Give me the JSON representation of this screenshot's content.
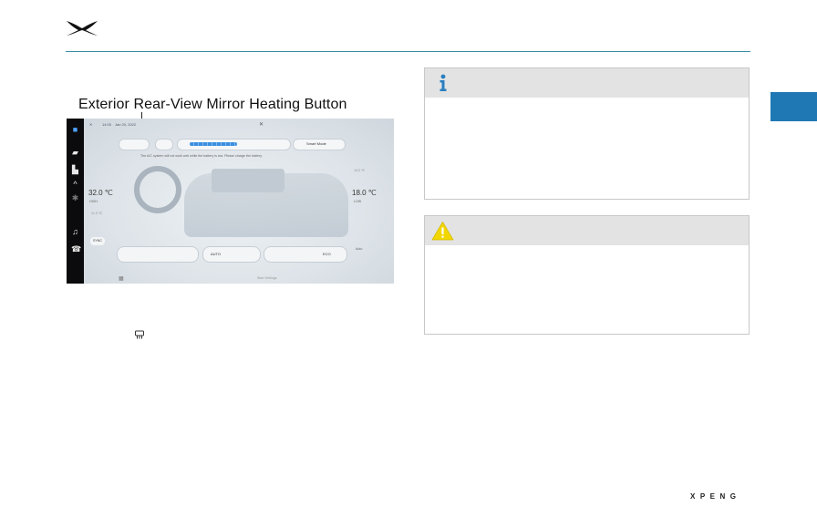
{
  "header": {
    "logo_icon": "xpeng-x-logo-icon",
    "rule_color": "#3a8fa6"
  },
  "side_tab": {
    "color": "#1f78b4"
  },
  "figure": {
    "caption": "Exterior Rear-View Mirror Heating Button",
    "screen": {
      "status_time": "14:00",
      "status_date": "Jan 20, 2022",
      "smart_mode_label": "Smart Mode",
      "notice": "The A/C system will not work well while the battery is low. Please charge the battery.",
      "left_temp": "32.0 ℃",
      "left_temp_sub": "HIGH",
      "left_temp_lower": "31.5 ℃",
      "right_temp": "18.0 ℃",
      "right_temp_sub": "LOW",
      "right_temp_upper": "18.5 ℃",
      "sync_label": "SYNC",
      "auto_label": "AUTO",
      "eco_label": "ECO",
      "mode_label": "Auto",
      "bottom_hint": "Start Settings",
      "sidebar_icons": [
        "car-icon",
        "seat-icon",
        "chevron-up-icon",
        "fan-icon",
        "music-icon",
        "phone-icon"
      ]
    }
  },
  "inline_icon": "rear-defrost-icon",
  "notes": [
    {
      "type": "info",
      "icon": "info-icon",
      "icon_color": "#2a7fc0"
    },
    {
      "type": "warning",
      "icon": "warning-icon",
      "icon_color": "#f2d600"
    }
  ],
  "footer": {
    "brand": "XPENG"
  }
}
